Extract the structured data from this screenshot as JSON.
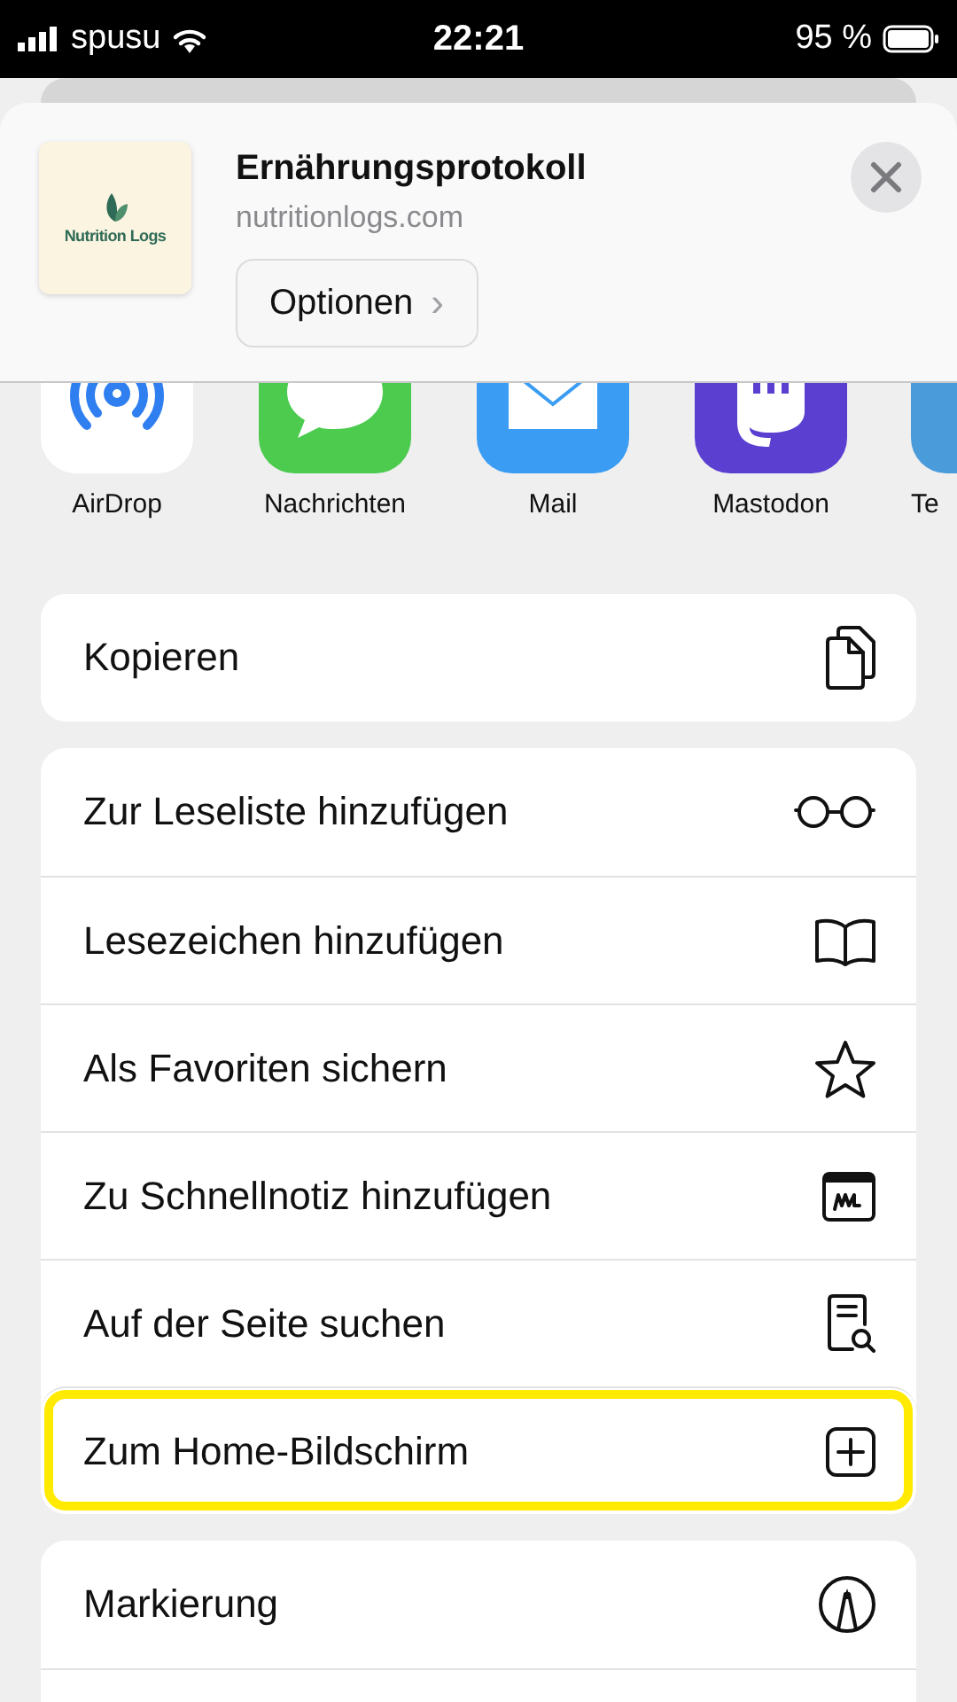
{
  "status_bar": {
    "carrier": "spusu",
    "time": "22:21",
    "battery": "95 %"
  },
  "header": {
    "logo_text": "Nutrition Logs",
    "title": "Ernährungsprotokoll",
    "domain": "nutritionlogs.com",
    "options_button": "Optionen",
    "options_chevron": "›"
  },
  "apps": [
    {
      "label": "AirDrop",
      "kind": "airdrop"
    },
    {
      "label": "Nachrichten",
      "kind": "messages"
    },
    {
      "label": "Mail",
      "kind": "mail"
    },
    {
      "label": "Mastodon",
      "kind": "mastodon"
    },
    {
      "label": "Te",
      "kind": "partial"
    }
  ],
  "groups": [
    [
      {
        "label": "Kopieren",
        "kind": "copy",
        "highlighted": false
      }
    ],
    [
      {
        "label": "Zur Leseliste hinzufügen",
        "kind": "glasses",
        "highlighted": false
      },
      {
        "label": "Lesezeichen hinzufügen",
        "kind": "book",
        "highlighted": false
      },
      {
        "label": "Als Favoriten sichern",
        "kind": "star",
        "highlighted": false
      },
      {
        "label": "Zu Schnellnotiz hinzufügen",
        "kind": "note",
        "highlighted": false
      },
      {
        "label": "Auf der Seite suchen",
        "kind": "search",
        "highlighted": false
      },
      {
        "label": "Zum Home-Bildschirm",
        "kind": "add",
        "highlighted": true
      }
    ],
    [
      {
        "label": "Markierung",
        "kind": "pen",
        "highlighted": false
      },
      {
        "kind": "partial",
        "highlighted": false
      }
    ]
  ]
}
